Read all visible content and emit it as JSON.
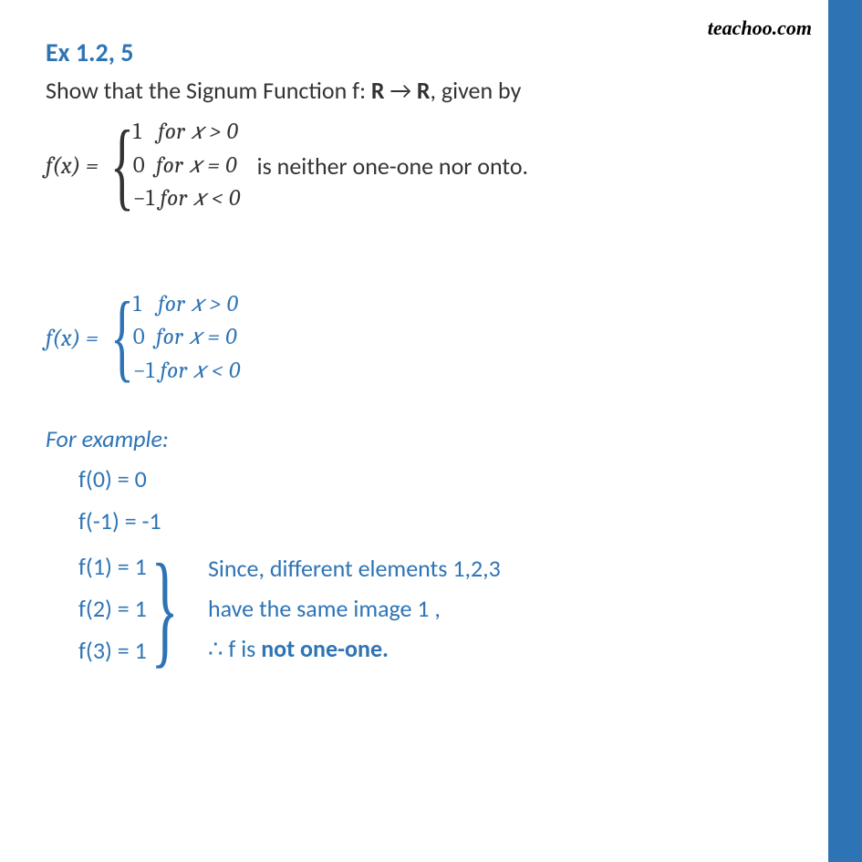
{
  "logo": "teachoo.com",
  "heading": "Ex 1.2, 5",
  "question": {
    "prefix": "Show that the Signum Function f: ",
    "domain": "R",
    "arrow": " → ",
    "codomain": "R",
    "suffix": ", given by"
  },
  "piecewise": {
    "label": "f(x)  = ",
    "rows": [
      {
        "val": "1",
        "cond": "for 𝑥  >  0"
      },
      {
        "val": " 0",
        "cond": "for 𝑥  =  0"
      },
      {
        "val": "−1",
        "cond": "for 𝑥  <  0"
      }
    ],
    "after": "is neither one-one nor onto."
  },
  "piecewise2": {
    "label": "f(x)  = ",
    "rows": [
      {
        "val": "1",
        "cond": "for 𝑥  >  0"
      },
      {
        "val": " 0",
        "cond": "for 𝑥  =  0"
      },
      {
        "val": "−1",
        "cond": "for 𝑥  <  0"
      }
    ]
  },
  "example_heading": "For example:",
  "examples_top": [
    "f(0) = 0",
    "f(-1) = -1"
  ],
  "examples_group": [
    "f(1) = 1",
    "f(2) = 1",
    "f(3) = 1"
  ],
  "conclusion": {
    "l1": "Since, different elements 1,2,3",
    "l2": "have the same image 1 ,",
    "l3a": "∴ f is ",
    "l3b": "not one-one."
  }
}
